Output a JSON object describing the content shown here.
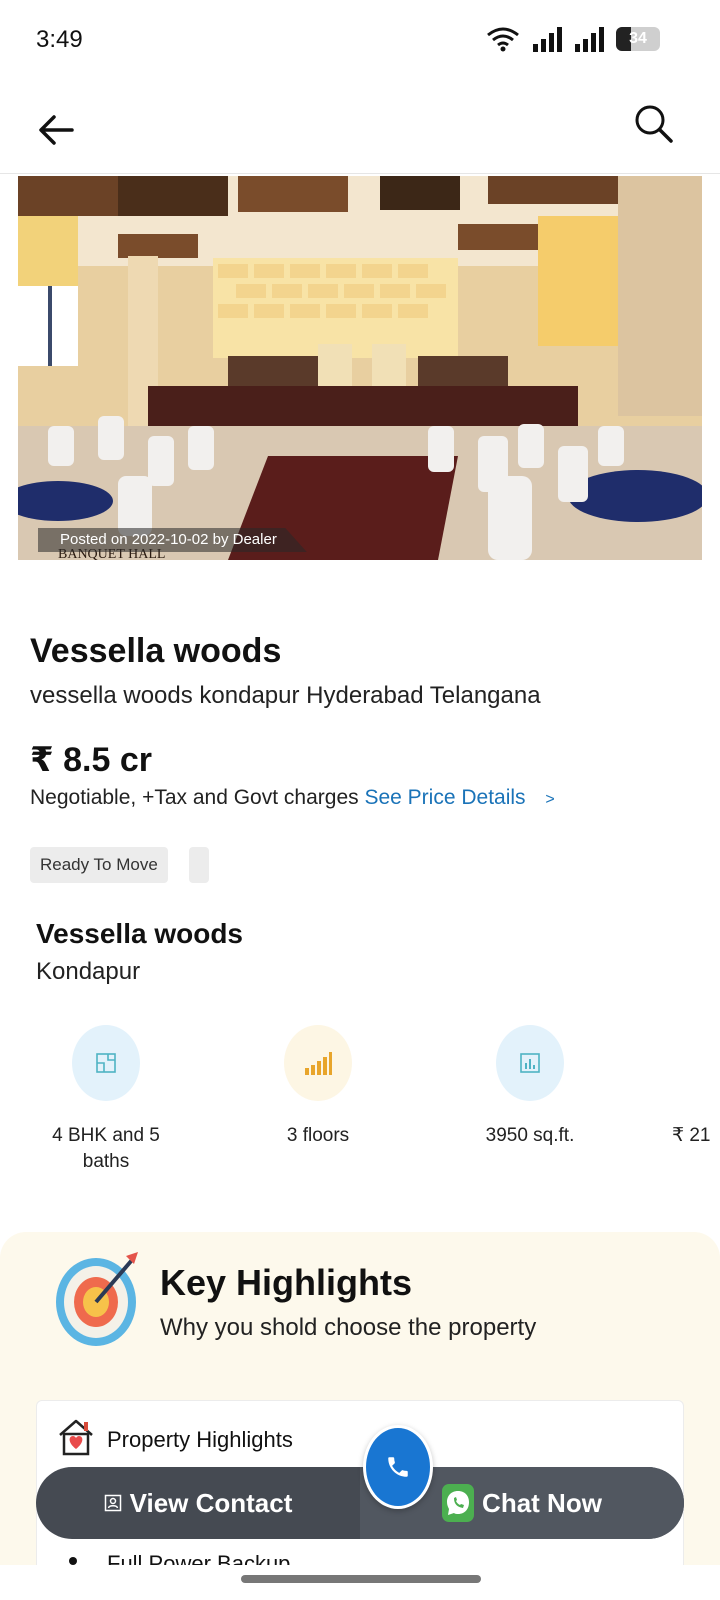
{
  "status_bar": {
    "time": "3:49",
    "battery": "34"
  },
  "app_bar": {
    "back_icon": "arrow-left-icon",
    "search_icon": "search-icon"
  },
  "hero": {
    "posted_text": "Posted on 2022-10-02 by Dealer",
    "image_caption": "BANQUET HALL"
  },
  "property": {
    "title": "Vessella woods",
    "address": "vessella woods kondapur Hyderabad Telangana",
    "price": "₹ 8.5 cr",
    "price_note": "Negotiable, +Tax and Govt charges",
    "price_link": "See Price Details",
    "chip": "Ready To Move"
  },
  "project": {
    "name": "Vessella woods",
    "location": "Kondapur"
  },
  "features": [
    {
      "label_line1": "4 BHK and 5",
      "label_line2": "baths",
      "icon": "floorplan-icon",
      "color": "#e3f2fb"
    },
    {
      "label_line1": "3 floors",
      "label_line2": "",
      "icon": "floors-bars-icon",
      "color": "#fdf6e4"
    },
    {
      "label_line1": "3950 sq.ft.",
      "label_line2": "",
      "icon": "area-chart-icon",
      "color": "#e3f2fb"
    },
    {
      "label_line1": "₹ 21",
      "label_line2": "",
      "icon": "price-icon",
      "color": "#ffffff"
    }
  ],
  "highlights": {
    "title": "Key Highlights",
    "subtitle": "Why you shold choose the property",
    "card_title": "Property Highlights",
    "first_item": "Full Power Backup"
  },
  "cta": {
    "view_contact": "View Contact",
    "chat_now": "Chat Now"
  },
  "colors": {
    "link": "#1a73b8",
    "cta_bar": "#454a52",
    "call_fab": "#1976d2",
    "highlight_bg": "#fdf9ec"
  }
}
